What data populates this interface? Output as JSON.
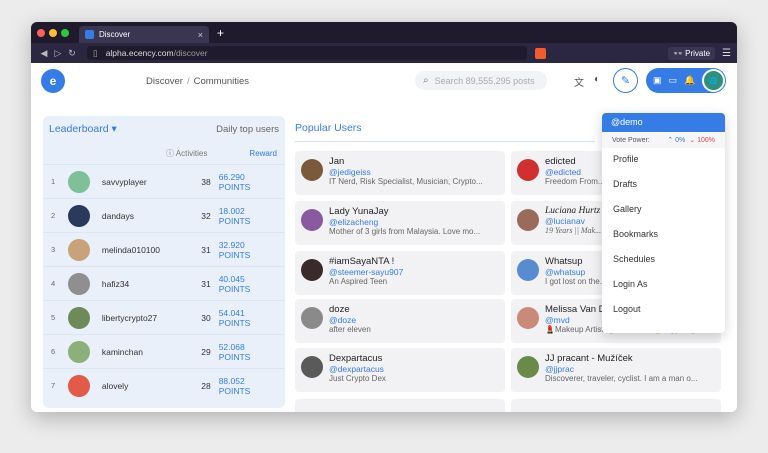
{
  "browser": {
    "tab_title": "Discover",
    "new_tab": "+",
    "close_tab": "×",
    "url_host": "alpha.ecency.com",
    "url_path": "/discover",
    "private_label": "Private"
  },
  "header": {
    "breadcrumb": [
      "Discover",
      "Communities"
    ],
    "breadcrumb_sep": "/",
    "search_placeholder": "Search 89,555,295 posts"
  },
  "leaderboard": {
    "title": "Leaderboard ▾",
    "period": "Daily top users",
    "col_activities": "Activities",
    "col_reward": "Reward",
    "rows": [
      {
        "rank": "1",
        "name": "savvyplayer",
        "score": "38",
        "points": "66.290 POINTS",
        "color": "#7fbf9a"
      },
      {
        "rank": "2",
        "name": "dandays",
        "score": "32",
        "points": "18.002 POINTS",
        "color": "#2a3a5c"
      },
      {
        "rank": "3",
        "name": "melinda010100",
        "score": "31",
        "points": "32.920 POINTS",
        "color": "#c7a27a"
      },
      {
        "rank": "4",
        "name": "hafiz34",
        "score": "31",
        "points": "40.045 POINTS",
        "color": "#8f8f8f"
      },
      {
        "rank": "5",
        "name": "libertycrypto27",
        "score": "30",
        "points": "54.041 POINTS",
        "color": "#6f8a5a"
      },
      {
        "rank": "6",
        "name": "kaminchan",
        "score": "29",
        "points": "52.068 POINTS",
        "color": "#8bb07a"
      },
      {
        "rank": "7",
        "name": "alovely",
        "score": "28",
        "points": "88.052 POINTS",
        "color": "#e25a4a"
      }
    ]
  },
  "popular": {
    "title": "Popular Users",
    "cards": [
      {
        "name": "Jan",
        "handle": "@jedigeiss",
        "bio": "IT Nerd, Risk Specialist, Musician, Crypto...",
        "color": "#7a5a3a"
      },
      {
        "name": "edicted",
        "handle": "@edicted",
        "bio": "Freedom From...",
        "color": "#d03030"
      },
      {
        "name": "Lady YunaJay",
        "handle": "@elizacheng",
        "bio": "Mother of 3 girls from Malaysia. Love mo...",
        "color": "#8a5aa0"
      },
      {
        "name": "Luciana Hurtz",
        "handle": "@lucianav",
        "bio": "19 Years || Mak...",
        "color": "#9a6a5a"
      },
      {
        "name": "#iamSayaNTA !",
        "handle": "@steemer-sayu907",
        "bio": "An Aspired Teen",
        "color": "#3a2a2a"
      },
      {
        "name": "Whatsup",
        "handle": "@whatsup",
        "bio": "I got lost on the...",
        "color": "#5a8ad0"
      },
      {
        "name": "doze",
        "handle": "@doze",
        "bio": "after eleven",
        "color": "#8a8a8a"
      },
      {
        "name": "Melissa Van Dijk",
        "handle": "@mvd",
        "bio": "💄Makeup Artist 🎨 SkinCare 🤞Crypto🛍",
        "color": "#c98a7a"
      },
      {
        "name": "Dexpartacus",
        "handle": "@dexpartacus",
        "bio": "Just Crypto Dex",
        "color": "#5a5a5a"
      },
      {
        "name": "JJ pracant - Mužíček",
        "handle": "@jjprac",
        "bio": "Discoverer, traveler, cyclist. I am a man o...",
        "color": "#6a8a4a"
      }
    ]
  },
  "user_menu": {
    "username": "@demo",
    "vote_power_label": "Vote Power:",
    "vp_low": "⌃ 0%",
    "vp_high": "⌄ 100%",
    "items": [
      "Profile",
      "Drafts",
      "Gallery",
      "Bookmarks",
      "Schedules",
      "Login As",
      "Logout"
    ]
  },
  "colors": {
    "accent": "#357ce6",
    "leader_bg": "#eaf0f9"
  }
}
